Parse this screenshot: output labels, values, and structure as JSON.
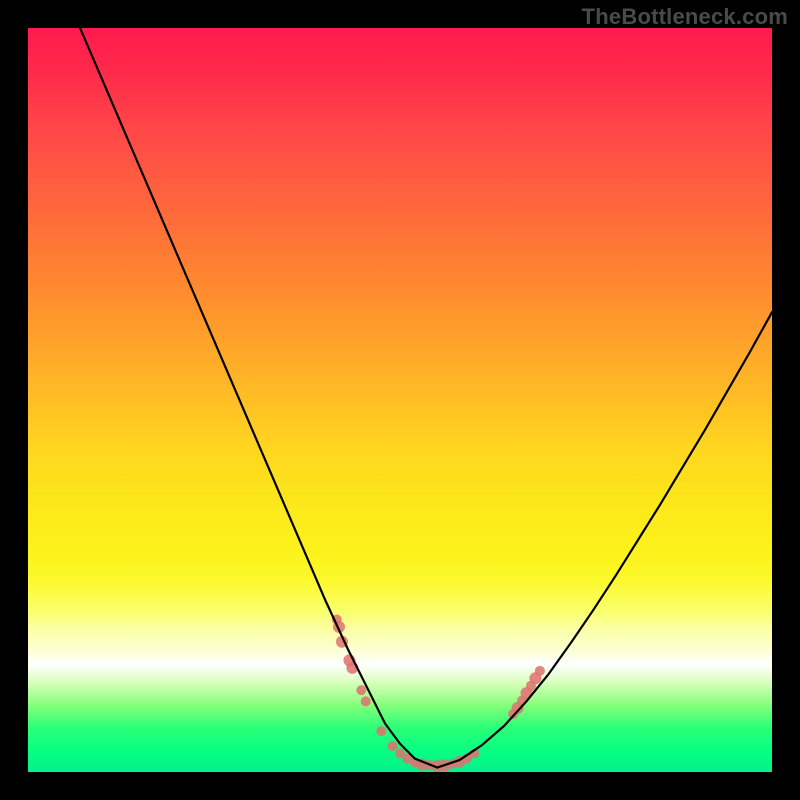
{
  "watermark": "TheBottleneck.com",
  "chart_data": {
    "type": "line",
    "title": "",
    "xlabel": "",
    "ylabel": "",
    "xlim": [
      0,
      100
    ],
    "ylim": [
      0,
      100
    ],
    "grid": false,
    "legend": false,
    "background_gradient": [
      "#ff1a4d",
      "#ffb028",
      "#fcf21a",
      "#ffffff",
      "#04f08c"
    ],
    "series": [
      {
        "name": "left-curve",
        "x": [
          7,
          10,
          13,
          16,
          19,
          22,
          25,
          28,
          31,
          34,
          37,
          40,
          43,
          46,
          48,
          50,
          52,
          55
        ],
        "values": [
          100,
          93,
          86,
          79,
          72,
          65,
          58,
          51,
          44,
          37,
          30,
          23,
          16.5,
          10.5,
          6.5,
          3.8,
          1.8,
          0.6
        ]
      },
      {
        "name": "right-curve",
        "x": [
          55,
          58,
          61,
          64,
          67,
          70,
          73,
          76,
          79,
          82,
          85,
          88,
          91,
          94,
          97,
          100
        ],
        "values": [
          0.6,
          1.6,
          3.6,
          6.2,
          9.5,
          13.2,
          17.4,
          21.8,
          26.4,
          31.2,
          36.0,
          41.0,
          46.0,
          51.2,
          56.4,
          61.8
        ]
      }
    ],
    "markers": {
      "name": "match-points",
      "points": [
        {
          "x": 41.5,
          "y": 20.5,
          "r": 5
        },
        {
          "x": 41.8,
          "y": 19.5,
          "r": 6
        },
        {
          "x": 42.2,
          "y": 17.5,
          "r": 6
        },
        {
          "x": 43.2,
          "y": 15.0,
          "r": 6
        },
        {
          "x": 43.6,
          "y": 14.0,
          "r": 6
        },
        {
          "x": 44.8,
          "y": 11.0,
          "r": 5
        },
        {
          "x": 45.4,
          "y": 9.5,
          "r": 5
        },
        {
          "x": 47.5,
          "y": 5.5,
          "r": 5
        },
        {
          "x": 49.0,
          "y": 3.5,
          "r": 5
        },
        {
          "x": 50.0,
          "y": 2.5,
          "r": 5
        },
        {
          "x": 51.0,
          "y": 1.8,
          "r": 5
        },
        {
          "x": 52.0,
          "y": 1.3,
          "r": 5
        },
        {
          "x": 53.0,
          "y": 1.0,
          "r": 6
        },
        {
          "x": 54.0,
          "y": 0.9,
          "r": 5
        },
        {
          "x": 55.0,
          "y": 0.8,
          "r": 6
        },
        {
          "x": 56.0,
          "y": 0.9,
          "r": 6
        },
        {
          "x": 57.0,
          "y": 1.1,
          "r": 5
        },
        {
          "x": 58.0,
          "y": 1.4,
          "r": 6
        },
        {
          "x": 59.0,
          "y": 1.8,
          "r": 5
        },
        {
          "x": 60.0,
          "y": 2.5,
          "r": 5
        },
        {
          "x": 65.2,
          "y": 7.8,
          "r": 5
        },
        {
          "x": 65.8,
          "y": 8.6,
          "r": 6
        },
        {
          "x": 66.4,
          "y": 9.6,
          "r": 5
        },
        {
          "x": 67.0,
          "y": 10.6,
          "r": 6
        },
        {
          "x": 67.6,
          "y": 11.6,
          "r": 5
        },
        {
          "x": 68.2,
          "y": 12.6,
          "r": 6
        },
        {
          "x": 68.8,
          "y": 13.6,
          "r": 5
        }
      ]
    }
  }
}
